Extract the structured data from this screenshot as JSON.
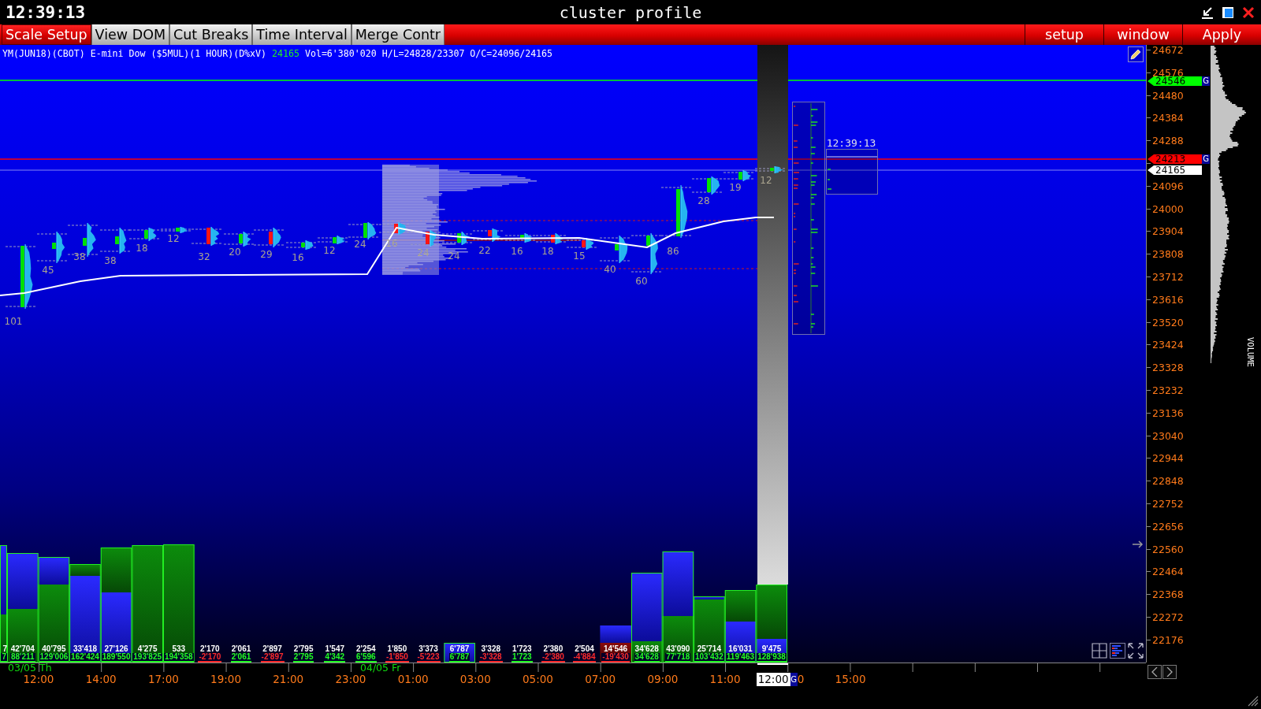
{
  "window": {
    "clock": "12:39:13",
    "title": "cluster profile"
  },
  "toolbar": {
    "left": [
      {
        "label": "Scale Setup",
        "on": false
      },
      {
        "label": "View DOM",
        "on": true
      },
      {
        "label": "Cut Breaks",
        "on": true
      },
      {
        "label": "Time Interval",
        "on": true
      },
      {
        "label": "Merge Contr",
        "on": true
      }
    ],
    "right": [
      "setup",
      "window",
      "Apply"
    ]
  },
  "info": {
    "symbol": "YM(JUN18)(CBOT) E-mini Dow ($5MUL)(1 HOUR)(D%xV)",
    "last": "24165",
    "stats": "Vol=6'380'020 H/L=24828/23307 O/C=24096/24165"
  },
  "clusters": [
    {
      "count": "101",
      "kind": "up"
    },
    {
      "count": "45",
      "kind": "up"
    },
    {
      "count": "38",
      "kind": "up"
    },
    {
      "count": "38",
      "kind": "up"
    },
    {
      "count": "18",
      "kind": "up"
    },
    {
      "count": "12",
      "kind": "up"
    },
    {
      "count": "32",
      "kind": "down"
    },
    {
      "count": "20",
      "kind": "up"
    },
    {
      "count": "29",
      "kind": "down"
    },
    {
      "count": "16",
      "kind": "up"
    },
    {
      "count": "12",
      "kind": "up"
    },
    {
      "count": "24",
      "kind": "up"
    },
    {
      "count": "16",
      "kind": "down"
    },
    {
      "count": "24",
      "kind": "down"
    },
    {
      "count": "24",
      "kind": "up"
    },
    {
      "count": "22",
      "kind": "down"
    },
    {
      "count": "16",
      "kind": "up"
    },
    {
      "count": "18",
      "kind": "down"
    },
    {
      "count": "15",
      "kind": "down"
    },
    {
      "count": "40",
      "kind": "up"
    },
    {
      "count": "60",
      "kind": "up"
    },
    {
      "count": "86",
      "kind": "up"
    },
    {
      "count": "28",
      "kind": "up"
    },
    {
      "count": "19",
      "kind": "up"
    },
    {
      "count": "12",
      "kind": "up"
    }
  ],
  "profile_box": {
    "time": "12:39:13"
  },
  "volume_columns": [
    {
      "volume": "7",
      "delta": "7",
      "color": "#22ff22"
    },
    {
      "volume": "42'704",
      "delta": "88'211",
      "color": "#22ff22"
    },
    {
      "volume": "40'795",
      "delta": "129'006",
      "color": "#22ff22"
    },
    {
      "volume": "33'418",
      "delta": "162'424",
      "color": "#22ff22"
    },
    {
      "volume": "27'126",
      "delta": "189'550",
      "color": "#22ff22"
    },
    {
      "volume": "4'275",
      "delta": "193'825",
      "color": "#22ff22"
    },
    {
      "volume": "533",
      "delta": "194'358",
      "color": "#22ff22"
    },
    {
      "volume": "2'170",
      "delta": "-2'170",
      "color": "#ff2a2a"
    },
    {
      "volume": "2'061",
      "delta": "2'061",
      "color": "#22ff22"
    },
    {
      "volume": "2'897",
      "delta": "-2'897",
      "color": "#ff2a2a"
    },
    {
      "volume": "2'795",
      "delta": "2'795",
      "color": "#22ff22"
    },
    {
      "volume": "1'547",
      "delta": "4'342",
      "color": "#22ff22"
    },
    {
      "volume": "2'254",
      "delta": "6'596",
      "color": "#22ff22"
    },
    {
      "volume": "1'850",
      "delta": "-1'850",
      "color": "#ff2a2a"
    },
    {
      "volume": "3'373",
      "delta": "-5'223",
      "color": "#ff2a2a"
    },
    {
      "volume": "6'787",
      "delta": "6'787",
      "color": "#22ff22"
    },
    {
      "volume": "3'328",
      "delta": "-3'328",
      "color": "#ff2a2a"
    },
    {
      "volume": "1'723",
      "delta": "1'723",
      "color": "#22ff22"
    },
    {
      "volume": "2'380",
      "delta": "-2'380",
      "color": "#ff2a2a"
    },
    {
      "volume": "2'504",
      "delta": "-4'884",
      "color": "#ff2a2a"
    },
    {
      "volume": "14'546",
      "delta": "-19'430",
      "color": "#ff2a2a"
    },
    {
      "volume": "34'628",
      "delta": "34'628",
      "color": "#22ff22"
    },
    {
      "volume": "43'090",
      "delta": "77'718",
      "color": "#22ff22"
    },
    {
      "volume": "25'714",
      "delta": "103'432",
      "color": "#22ff22"
    },
    {
      "volume": "16'031",
      "delta": "119'463",
      "color": "#22ff22"
    },
    {
      "volume": "9'475",
      "delta": "128'938",
      "color": "#22ff22"
    }
  ],
  "price_axis": {
    "labels": [
      "24672",
      "24576",
      "24480",
      "24384",
      "24288",
      "24096",
      "24000",
      "23904",
      "23808",
      "23712",
      "23616",
      "23520",
      "23424",
      "23328",
      "23232",
      "23136",
      "23040",
      "22944",
      "22848",
      "22752",
      "22656",
      "22560",
      "22464",
      "22368",
      "22272",
      "22176"
    ],
    "tags": [
      {
        "label": "24546",
        "color": "#00ff00",
        "badge": "G"
      },
      {
        "label": "24213",
        "color": "#ff0000",
        "badge": "G"
      },
      {
        "label": "24165",
        "color": "#ffffff"
      }
    ]
  },
  "side_profile": {
    "title": "VOLUME"
  },
  "time_axis": {
    "dates": [
      "03/05 Th",
      "04/05 Fr"
    ],
    "times": [
      {
        "label": "12:00",
        "kind": "tick"
      },
      {
        "label": "14:00",
        "kind": "tick"
      },
      {
        "label": "17:00",
        "kind": "tick"
      },
      {
        "label": "19:00",
        "kind": "tick"
      },
      {
        "label": "21:00",
        "kind": "tick"
      },
      {
        "label": "23:00",
        "kind": "tick"
      },
      {
        "label": "01:00",
        "kind": "tick"
      },
      {
        "label": "03:00",
        "kind": "tick"
      },
      {
        "label": "05:00",
        "kind": "tick"
      },
      {
        "label": "07:00",
        "kind": "tick"
      },
      {
        "label": "09:00",
        "kind": "tick"
      },
      {
        "label": "11:00",
        "kind": "tick"
      },
      {
        "label": "12:00",
        "kind": "current",
        "badge": "G"
      },
      {
        "label": "0",
        "kind": "partial"
      },
      {
        "label": "15:00",
        "kind": "tick"
      }
    ]
  }
}
